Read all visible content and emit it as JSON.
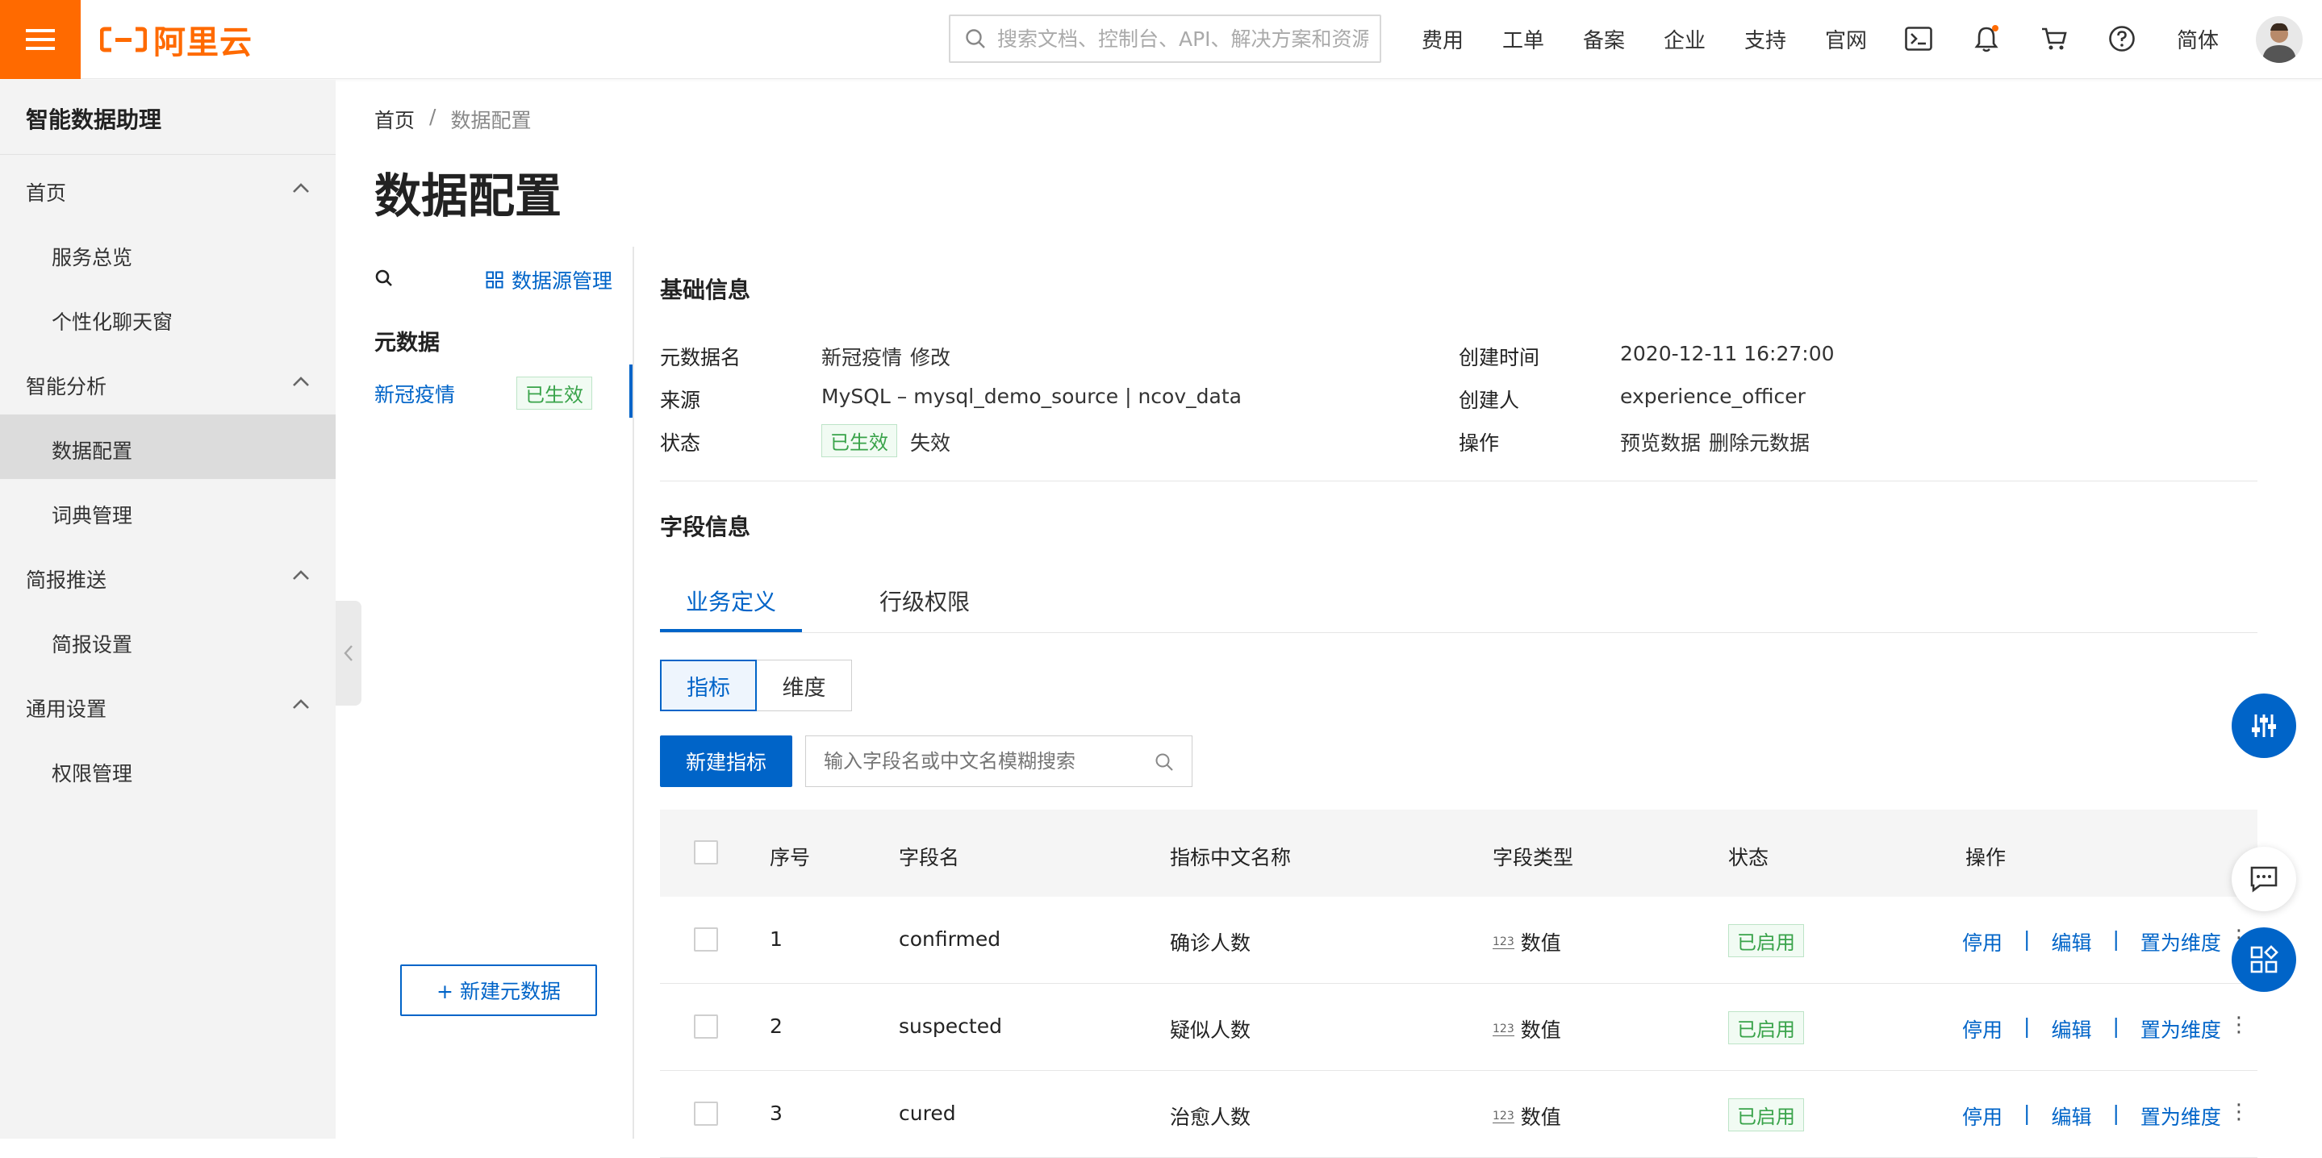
{
  "topbar": {
    "brand": "阿里云",
    "search_placeholder": "搜索文档、控制台、API、解决方案和资源",
    "nav": [
      "费用",
      "工单",
      "备案",
      "企业",
      "支持",
      "官网"
    ],
    "language": "简体",
    "accent_color": "#ff6a00"
  },
  "sidebar": {
    "title": "智能数据助理",
    "groups": [
      {
        "label": "首页",
        "items": [
          "服务总览",
          "个性化聊天窗"
        ]
      },
      {
        "label": "智能分析",
        "items": [
          "数据配置",
          "词典管理"
        ]
      },
      {
        "label": "简报推送",
        "items": [
          "简报设置"
        ]
      },
      {
        "label": "通用设置",
        "items": [
          "权限管理"
        ]
      }
    ],
    "active_item": "数据配置"
  },
  "breadcrumb": {
    "home": "首页",
    "sep": "/",
    "current": "数据配置"
  },
  "page_title": "数据配置",
  "meta_panel": {
    "source_manage": "数据源管理",
    "heading": "元数据",
    "item_name": "新冠疫情",
    "item_status": "已生效",
    "new_button": "+ 新建元数据"
  },
  "basic_info": {
    "title": "基础信息",
    "name_label": "元数据名",
    "name_value": "新冠疫情",
    "edit_link": "修改",
    "source_label": "来源",
    "source_value": "MySQL – mysql_demo_source | ncov_data",
    "status_label": "状态",
    "status_value": "已生效",
    "invalidate_link": "失效",
    "created_time_label": "创建时间",
    "created_time_value": "2020-12-11 16:27:00",
    "creator_label": "创建人",
    "creator_value": "experience_officer",
    "ops_label": "操作",
    "preview_link": "预览数据",
    "delete_link": "删除元数据"
  },
  "field_info": {
    "title": "字段信息",
    "tabs": [
      "业务定义",
      "行级权限"
    ],
    "segments": [
      "指标",
      "维度"
    ],
    "new_metric_button": "新建指标",
    "search_placeholder": "输入字段名或中文名模糊搜索"
  },
  "table": {
    "headers": [
      "序号",
      "字段名",
      "指标中文名称",
      "字段类型",
      "状态",
      "操作"
    ],
    "rows": [
      {
        "index": "1",
        "field": "confirmed",
        "cn_name": "确诊人数",
        "type_icon": "123",
        "type": "数值",
        "status": "已启用"
      },
      {
        "index": "2",
        "field": "suspected",
        "cn_name": "疑似人数",
        "type_icon": "123",
        "type": "数值",
        "status": "已启用"
      },
      {
        "index": "3",
        "field": "cured",
        "cn_name": "治愈人数",
        "type_icon": "123",
        "type": "数值",
        "status": "已启用"
      }
    ],
    "ops": {
      "disable": "停用",
      "edit": "编辑",
      "set_dimension": "置为维度",
      "sep": "|"
    }
  }
}
